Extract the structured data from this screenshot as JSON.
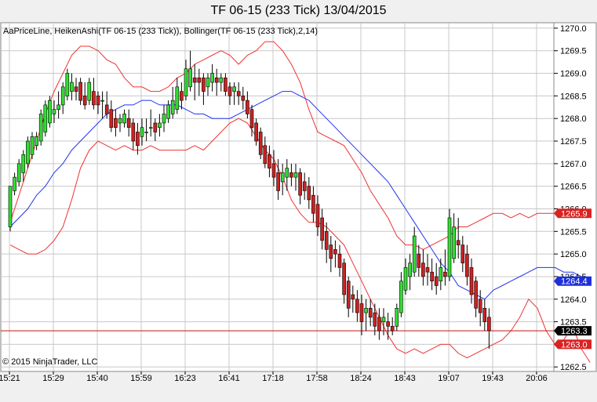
{
  "title": "TF 06-15 (233 Tick)  13/04/2015",
  "indicator_label": "AaPriceLine, HeikenAshi(TF 06-15 (233 Tick)), Bollinger(TF 06-15 (233 Tick),2,14)",
  "copyright": "© 2015 NinjaTrader, LLC",
  "colors": {
    "up": "#33dd33",
    "down": "#cc2222",
    "band": "#ee3333",
    "mid": "#2233ee",
    "priceline": "#cc1111",
    "grid": "#c8c8c8",
    "bg": "#ffffff"
  },
  "chart_data": {
    "type": "candlestick",
    "ylim": [
      1262.4,
      1270.12
    ],
    "y_ticks": [
      "1262.5",
      "1263.0",
      "1263.5",
      "1264.0",
      "1264.5",
      "1265.0",
      "1265.5",
      "1266.0",
      "1266.5",
      "1267.0",
      "1267.5",
      "1268.0",
      "1268.5",
      "1269.0",
      "1269.5",
      "1270.0"
    ],
    "x_ticks": [
      "15:21",
      "15:29",
      "15:40",
      "15:59",
      "16:23",
      "16:41",
      "17:18",
      "17:58",
      "18:24",
      "18:43",
      "19:07",
      "19:43",
      "20:06"
    ],
    "x_tick_bars": [
      0,
      10,
      20,
      30,
      40,
      50,
      60,
      70,
      80,
      90,
      100,
      110,
      120
    ],
    "candles": [
      [
        1265.6,
        1266.5,
        1265.5,
        1266.5
      ],
      [
        1266.4,
        1266.8,
        1266.3,
        1266.7
      ],
      [
        1266.6,
        1267.1,
        1266.5,
        1267.0
      ],
      [
        1266.8,
        1267.3,
        1266.6,
        1267.2
      ],
      [
        1267.0,
        1267.6,
        1266.9,
        1267.5
      ],
      [
        1267.2,
        1267.7,
        1267.1,
        1267.6
      ],
      [
        1267.4,
        1267.7,
        1267.3,
        1267.6
      ],
      [
        1267.5,
        1268.2,
        1267.4,
        1268.1
      ],
      [
        1267.7,
        1268.4,
        1267.6,
        1268.3
      ],
      [
        1267.9,
        1268.5,
        1267.8,
        1268.4
      ],
      [
        1268.1,
        1268.4,
        1267.9,
        1268.2
      ],
      [
        1268.2,
        1268.6,
        1268.0,
        1268.3
      ],
      [
        1268.3,
        1268.8,
        1268.1,
        1268.7
      ],
      [
        1268.5,
        1269.1,
        1268.4,
        1269.0
      ],
      [
        1268.6,
        1269.0,
        1268.4,
        1268.8
      ],
      [
        1268.7,
        1268.9,
        1268.4,
        1268.6
      ],
      [
        1268.8,
        1268.9,
        1268.3,
        1268.4
      ],
      [
        1268.5,
        1268.8,
        1268.2,
        1268.3
      ],
      [
        1268.4,
        1268.9,
        1268.3,
        1268.8
      ],
      [
        1268.6,
        1268.9,
        1268.2,
        1268.3
      ],
      [
        1268.5,
        1268.6,
        1268.1,
        1268.3
      ],
      [
        1268.4,
        1268.6,
        1268.0,
        1268.4
      ],
      [
        1268.3,
        1268.6,
        1268.0,
        1268.1
      ],
      [
        1268.2,
        1268.4,
        1267.7,
        1267.8
      ],
      [
        1268.0,
        1268.2,
        1267.6,
        1267.8
      ],
      [
        1267.9,
        1268.1,
        1267.7,
        1268.0
      ],
      [
        1267.9,
        1268.2,
        1267.8,
        1268.1
      ],
      [
        1268.0,
        1268.2,
        1267.6,
        1267.8
      ],
      [
        1267.9,
        1268.0,
        1267.3,
        1267.5
      ],
      [
        1267.7,
        1267.9,
        1267.2,
        1267.4
      ],
      [
        1267.6,
        1268.0,
        1267.4,
        1267.8
      ],
      [
        1267.7,
        1268.0,
        1267.5,
        1267.7
      ],
      [
        1267.8,
        1268.2,
        1267.6,
        1267.8
      ],
      [
        1267.9,
        1268.0,
        1267.5,
        1267.7
      ],
      [
        1267.8,
        1268.1,
        1267.6,
        1267.9
      ],
      [
        1267.9,
        1268.3,
        1267.7,
        1268.1
      ],
      [
        1268.0,
        1268.4,
        1267.9,
        1268.3
      ],
      [
        1268.1,
        1268.7,
        1268.0,
        1268.4
      ],
      [
        1268.2,
        1268.9,
        1268.1,
        1268.7
      ],
      [
        1268.6,
        1268.8,
        1268.2,
        1268.4
      ],
      [
        1268.5,
        1269.3,
        1268.4,
        1269.1
      ],
      [
        1268.7,
        1269.5,
        1268.6,
        1269.1
      ],
      [
        1268.9,
        1269.2,
        1268.4,
        1268.8
      ],
      [
        1268.9,
        1269.1,
        1268.5,
        1268.8
      ],
      [
        1268.9,
        1269.0,
        1268.3,
        1268.6
      ],
      [
        1268.7,
        1269.0,
        1268.5,
        1268.9
      ],
      [
        1268.8,
        1269.2,
        1268.6,
        1269.0
      ],
      [
        1268.9,
        1269.1,
        1268.5,
        1268.8
      ],
      [
        1268.8,
        1269.0,
        1268.6,
        1268.9
      ],
      [
        1268.9,
        1269.0,
        1268.5,
        1268.6
      ],
      [
        1268.7,
        1268.8,
        1268.3,
        1268.5
      ],
      [
        1268.6,
        1268.8,
        1268.3,
        1268.7
      ],
      [
        1268.6,
        1268.8,
        1268.3,
        1268.5
      ],
      [
        1268.5,
        1268.7,
        1268.2,
        1268.4
      ],
      [
        1268.4,
        1268.6,
        1268.0,
        1268.1
      ],
      [
        1268.2,
        1268.3,
        1267.6,
        1267.8
      ],
      [
        1267.9,
        1268.0,
        1267.4,
        1267.5
      ],
      [
        1267.7,
        1267.8,
        1267.1,
        1267.2
      ],
      [
        1267.4,
        1267.6,
        1266.9,
        1267.0
      ],
      [
        1267.2,
        1267.4,
        1266.7,
        1266.9
      ],
      [
        1267.0,
        1267.3,
        1266.5,
        1266.7
      ],
      [
        1266.8,
        1267.1,
        1266.2,
        1266.4
      ],
      [
        1266.6,
        1267.0,
        1266.3,
        1266.8
      ],
      [
        1266.7,
        1267.1,
        1266.4,
        1266.9
      ],
      [
        1266.8,
        1267.0,
        1266.5,
        1266.7
      ],
      [
        1266.7,
        1267.0,
        1266.4,
        1266.8
      ],
      [
        1266.8,
        1266.9,
        1266.1,
        1266.3
      ],
      [
        1266.6,
        1266.8,
        1266.2,
        1266.4
      ],
      [
        1266.5,
        1266.7,
        1266.0,
        1266.2
      ],
      [
        1266.3,
        1266.5,
        1265.7,
        1265.9
      ],
      [
        1266.1,
        1266.3,
        1265.4,
        1265.6
      ],
      [
        1265.8,
        1266.0,
        1265.1,
        1265.3
      ],
      [
        1265.5,
        1265.7,
        1264.8,
        1265.1
      ],
      [
        1265.2,
        1265.4,
        1264.6,
        1264.9
      ],
      [
        1265.1,
        1265.3,
        1264.7,
        1265.0
      ],
      [
        1265.0,
        1265.2,
        1264.5,
        1264.7
      ],
      [
        1264.8,
        1264.9,
        1263.9,
        1264.1
      ],
      [
        1264.4,
        1264.5,
        1263.6,
        1263.8
      ],
      [
        1264.1,
        1264.3,
        1263.7,
        1264.0
      ],
      [
        1264.0,
        1264.2,
        1263.5,
        1263.7
      ],
      [
        1263.9,
        1264.1,
        1263.2,
        1263.5
      ],
      [
        1263.7,
        1264.0,
        1263.3,
        1263.8
      ],
      [
        1263.8,
        1264.0,
        1263.4,
        1263.6
      ],
      [
        1263.7,
        1263.9,
        1263.2,
        1263.4
      ],
      [
        1263.6,
        1263.8,
        1263.1,
        1263.3
      ],
      [
        1263.5,
        1263.8,
        1263.2,
        1263.6
      ],
      [
        1263.5,
        1263.7,
        1263.1,
        1263.4
      ],
      [
        1263.4,
        1263.6,
        1263.2,
        1263.3
      ],
      [
        1263.4,
        1263.9,
        1263.3,
        1263.8
      ],
      [
        1263.7,
        1264.6,
        1263.6,
        1264.4
      ],
      [
        1264.2,
        1264.9,
        1264.1,
        1264.7
      ],
      [
        1264.5,
        1265.0,
        1264.2,
        1264.8
      ],
      [
        1264.6,
        1265.6,
        1264.5,
        1265.4
      ],
      [
        1265.0,
        1265.2,
        1264.5,
        1264.7
      ],
      [
        1264.8,
        1265.1,
        1264.3,
        1264.5
      ],
      [
        1264.7,
        1265.0,
        1264.3,
        1264.6
      ],
      [
        1264.6,
        1264.9,
        1264.2,
        1264.4
      ],
      [
        1264.5,
        1264.8,
        1264.1,
        1264.3
      ],
      [
        1264.4,
        1264.9,
        1264.2,
        1264.7
      ],
      [
        1264.6,
        1265.1,
        1264.3,
        1264.5
      ],
      [
        1264.5,
        1266.0,
        1264.4,
        1265.8
      ],
      [
        1264.9,
        1265.9,
        1264.8,
        1265.6
      ],
      [
        1265.3,
        1265.8,
        1264.9,
        1265.2
      ],
      [
        1265.2,
        1265.4,
        1264.6,
        1264.8
      ],
      [
        1265.0,
        1265.2,
        1264.3,
        1264.5
      ],
      [
        1264.7,
        1264.9,
        1263.9,
        1264.1
      ],
      [
        1264.4,
        1264.5,
        1263.6,
        1263.8
      ],
      [
        1264.0,
        1264.2,
        1263.4,
        1263.7
      ],
      [
        1263.8,
        1264.0,
        1263.3,
        1263.5
      ],
      [
        1263.6,
        1263.8,
        1262.9,
        1263.3
      ]
    ],
    "mid_band": [
      1265.6,
      1265.8,
      1266.0,
      1266.3,
      1266.5,
      1266.8,
      1267.0,
      1267.3,
      1267.5,
      1267.7,
      1267.9,
      1268.1,
      1268.2,
      1268.3,
      1268.3,
      1268.4,
      1268.4,
      1268.3,
      1268.3,
      1268.3,
      1268.2,
      1268.1,
      1268.1,
      1268.0,
      1268.0,
      1268.0,
      1268.1,
      1268.2,
      1268.3,
      1268.4,
      1268.5,
      1268.6,
      1268.6,
      1268.5,
      1268.4,
      1268.2,
      1268.0,
      1267.8,
      1267.6,
      1267.4,
      1267.2,
      1267.0,
      1266.8,
      1266.6,
      1266.3,
      1266.0,
      1265.7,
      1265.4,
      1265.1,
      1264.8,
      1264.6,
      1264.3,
      1264.2,
      1264.1,
      1264.0,
      1264.2,
      1264.3,
      1264.4,
      1264.5,
      1264.6,
      1264.7,
      1264.7,
      1264.7,
      1264.6,
      1264.6,
      1264.5,
      1264.4
    ],
    "upper_band": [
      1265.7,
      1266.3,
      1266.9,
      1267.5,
      1268.1,
      1268.6,
      1269.0,
      1269.4,
      1269.6,
      1269.6,
      1269.5,
      1269.3,
      1269.2,
      1268.9,
      1268.7,
      1268.7,
      1268.6,
      1268.6,
      1268.7,
      1268.9,
      1269.0,
      1269.2,
      1269.3,
      1269.4,
      1269.5,
      1269.4,
      1269.2,
      1269.4,
      1269.5,
      1269.7,
      1269.7,
      1269.5,
      1269.2,
      1268.8,
      1268.2,
      1267.7,
      1267.6,
      1267.5,
      1267.4,
      1267.1,
      1266.8,
      1266.4,
      1266.1,
      1265.8,
      1265.4,
      1265.2,
      1265.2,
      1265.1,
      1265.2,
      1265.3,
      1265.4,
      1265.6,
      1265.6,
      1265.7,
      1265.8,
      1265.9,
      1265.9,
      1265.8,
      1265.9,
      1265.8,
      1265.9,
      1265.9,
      1265.9,
      1265.9,
      1265.9,
      1265.9,
      1265.9
    ],
    "lower_band": [
      1265.2,
      1265.1,
      1265.0,
      1265.0,
      1265.1,
      1265.3,
      1265.6,
      1266.2,
      1266.9,
      1267.3,
      1267.5,
      1267.4,
      1267.3,
      1267.4,
      1267.3,
      1267.3,
      1267.4,
      1267.3,
      1267.3,
      1267.3,
      1267.3,
      1267.4,
      1267.3,
      1267.5,
      1267.7,
      1267.9,
      1268.0,
      1267.9,
      1267.6,
      1267.3,
      1267.1,
      1266.7,
      1266.2,
      1265.9,
      1265.7,
      1265.7,
      1265.6,
      1265.4,
      1265.2,
      1264.8,
      1264.4,
      1264.0,
      1263.6,
      1263.2,
      1262.9,
      1262.8,
      1262.9,
      1262.8,
      1262.9,
      1263.0,
      1263.0,
      1262.8,
      1262.7,
      1262.8,
      1262.9,
      1263.0,
      1263.1,
      1263.3,
      1263.6,
      1264.0,
      1263.8,
      1263.3,
      1263.0,
      1263.1,
      1263.4,
      1262.9,
      1262.6
    ],
    "band_step": 2,
    "price_line": 1263.3,
    "labels": [
      {
        "value": 1265.9,
        "text": "1265.9",
        "color": "#d92222"
      },
      {
        "value": 1264.4,
        "text": "1264.4",
        "color": "#1d2fd8"
      },
      {
        "value": 1263.3,
        "text": "1263.3",
        "color": "#000000"
      },
      {
        "value": 1263.0,
        "text": "1263.0",
        "color": "#d92222"
      }
    ]
  }
}
